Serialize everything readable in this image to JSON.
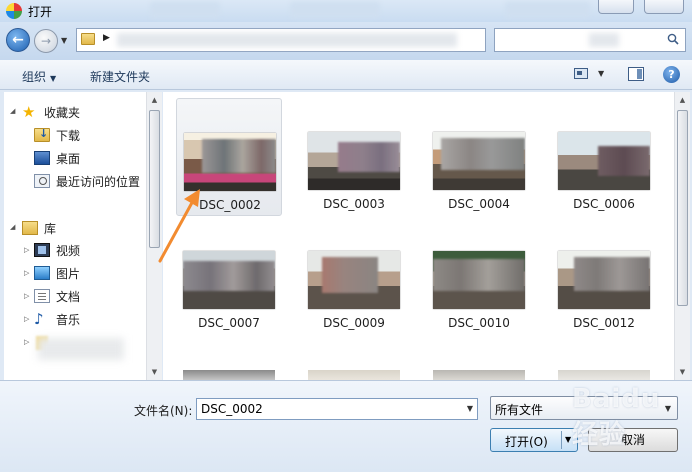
{
  "window": {
    "title": "打开"
  },
  "toolbar": {
    "organize": "组织",
    "new_folder": "新建文件夹"
  },
  "nav": {
    "favorites": "收藏夹",
    "downloads": "下载",
    "desktop": "桌面",
    "recent": "最近访问的位置",
    "libraries": "库",
    "videos": "视频",
    "pictures": "图片",
    "documents": "文档",
    "music": "音乐"
  },
  "files": [
    {
      "name": "DSC_0002",
      "selected": true
    },
    {
      "name": "DSC_0003",
      "selected": false
    },
    {
      "name": "DSC_0004",
      "selected": false
    },
    {
      "name": "DSC_0006",
      "selected": false
    },
    {
      "name": "DSC_0007",
      "selected": false
    },
    {
      "name": "DSC_0009",
      "selected": false
    },
    {
      "name": "DSC_0010",
      "selected": false
    },
    {
      "name": "DSC_0012",
      "selected": false
    }
  ],
  "bottom": {
    "filename_label": "文件名(N):",
    "filename_value": "DSC_0002",
    "filter_value": "所有文件",
    "open_label": "打开(O)",
    "cancel_label": "取消"
  },
  "colors": {
    "accent": "#f28b30",
    "window_frame": "#c9dcf1",
    "selection": "#e6e9ee"
  },
  "watermark": {
    "text": "Baidu 经验"
  }
}
